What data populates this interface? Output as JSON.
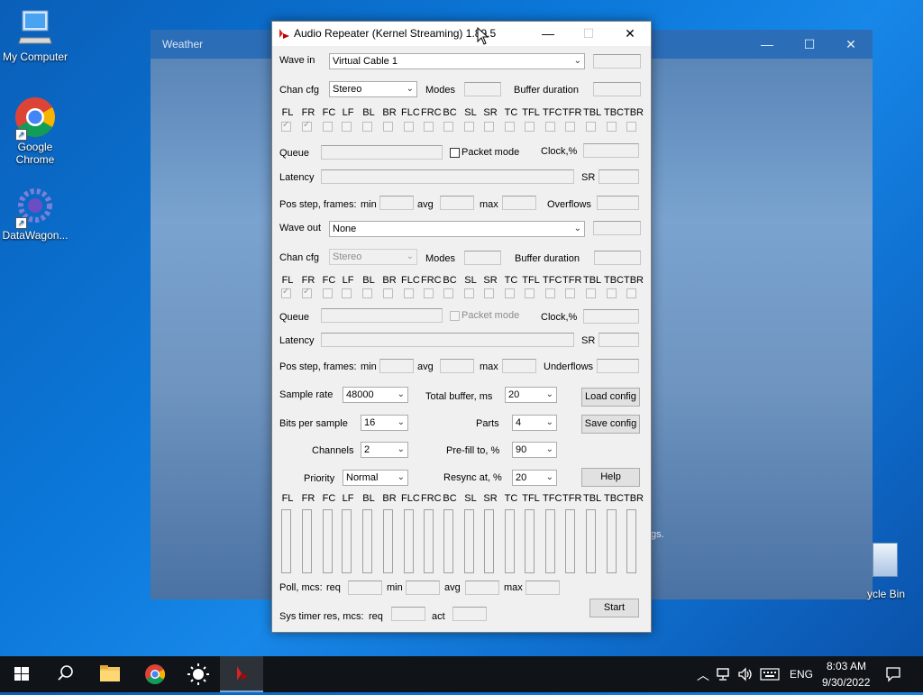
{
  "desktop": {
    "icons": [
      {
        "label": "My Computer"
      },
      {
        "label_line1": "Google",
        "label_line2": "Chrome"
      },
      {
        "label": "DataWagon..."
      }
    ],
    "recycle_label": "ycle Bin"
  },
  "weather": {
    "title": "Weather",
    "hint": "gs."
  },
  "app": {
    "title": "Audio Repeater (Kernel Streaming) 1.89.5",
    "channels": [
      "FL",
      "FR",
      "FC",
      "LF",
      "BL",
      "BR",
      "FLC",
      "FRC",
      "BC",
      "SL",
      "SR",
      "TC",
      "TFL",
      "TFC",
      "TFR",
      "TBL",
      "TBC",
      "TBR"
    ],
    "wave_in": {
      "label": "Wave in",
      "device": "Virtual Cable 1",
      "chan_cfg_label": "Chan cfg",
      "chan_cfg": "Stereo",
      "modes_label": "Modes",
      "buffer_duration_label": "Buffer duration",
      "queue_label": "Queue",
      "packet_mode_label": "Packet mode",
      "clock_label": "Clock,%",
      "latency_label": "Latency",
      "sr_label": "SR",
      "pos_step_label": "Pos step, frames:",
      "min_label": "min",
      "avg_label": "avg",
      "max_label": "max",
      "overflows_label": "Overflows"
    },
    "wave_out": {
      "label": "Wave out",
      "device": "None",
      "chan_cfg_label": "Chan cfg",
      "chan_cfg": "Stereo",
      "modes_label": "Modes",
      "buffer_duration_label": "Buffer duration",
      "queue_label": "Queue",
      "packet_mode_label": "Packet mode",
      "clock_label": "Clock,%",
      "latency_label": "Latency",
      "sr_label": "SR",
      "pos_step_label": "Pos step, frames:",
      "min_label": "min",
      "avg_label": "avg",
      "max_label": "max",
      "underflows_label": "Underflows"
    },
    "settings": {
      "sample_rate_label": "Sample rate",
      "sample_rate": "48000",
      "total_buffer_label": "Total buffer, ms",
      "total_buffer": "20",
      "bits_label": "Bits per sample",
      "bits": "16",
      "parts_label": "Parts",
      "parts": "4",
      "channels_label": "Channels",
      "channels": "2",
      "prefill_label": "Pre-fill to, %",
      "prefill": "90",
      "priority_label": "Priority",
      "priority": "Normal",
      "resync_label": "Resync at, %",
      "resync": "20"
    },
    "buttons": {
      "load": "Load config",
      "save": "Save config",
      "help": "Help",
      "start": "Start"
    },
    "poll": {
      "label": "Poll, mcs:",
      "req_label": "req",
      "min_label": "min",
      "avg_label": "avg",
      "max_label": "max"
    },
    "sys_timer": {
      "label": "Sys timer res, mcs:",
      "req_label": "req",
      "act_label": "act"
    }
  },
  "taskbar": {
    "language": "ENG",
    "time": "8:03 AM",
    "date": "9/30/2022"
  }
}
